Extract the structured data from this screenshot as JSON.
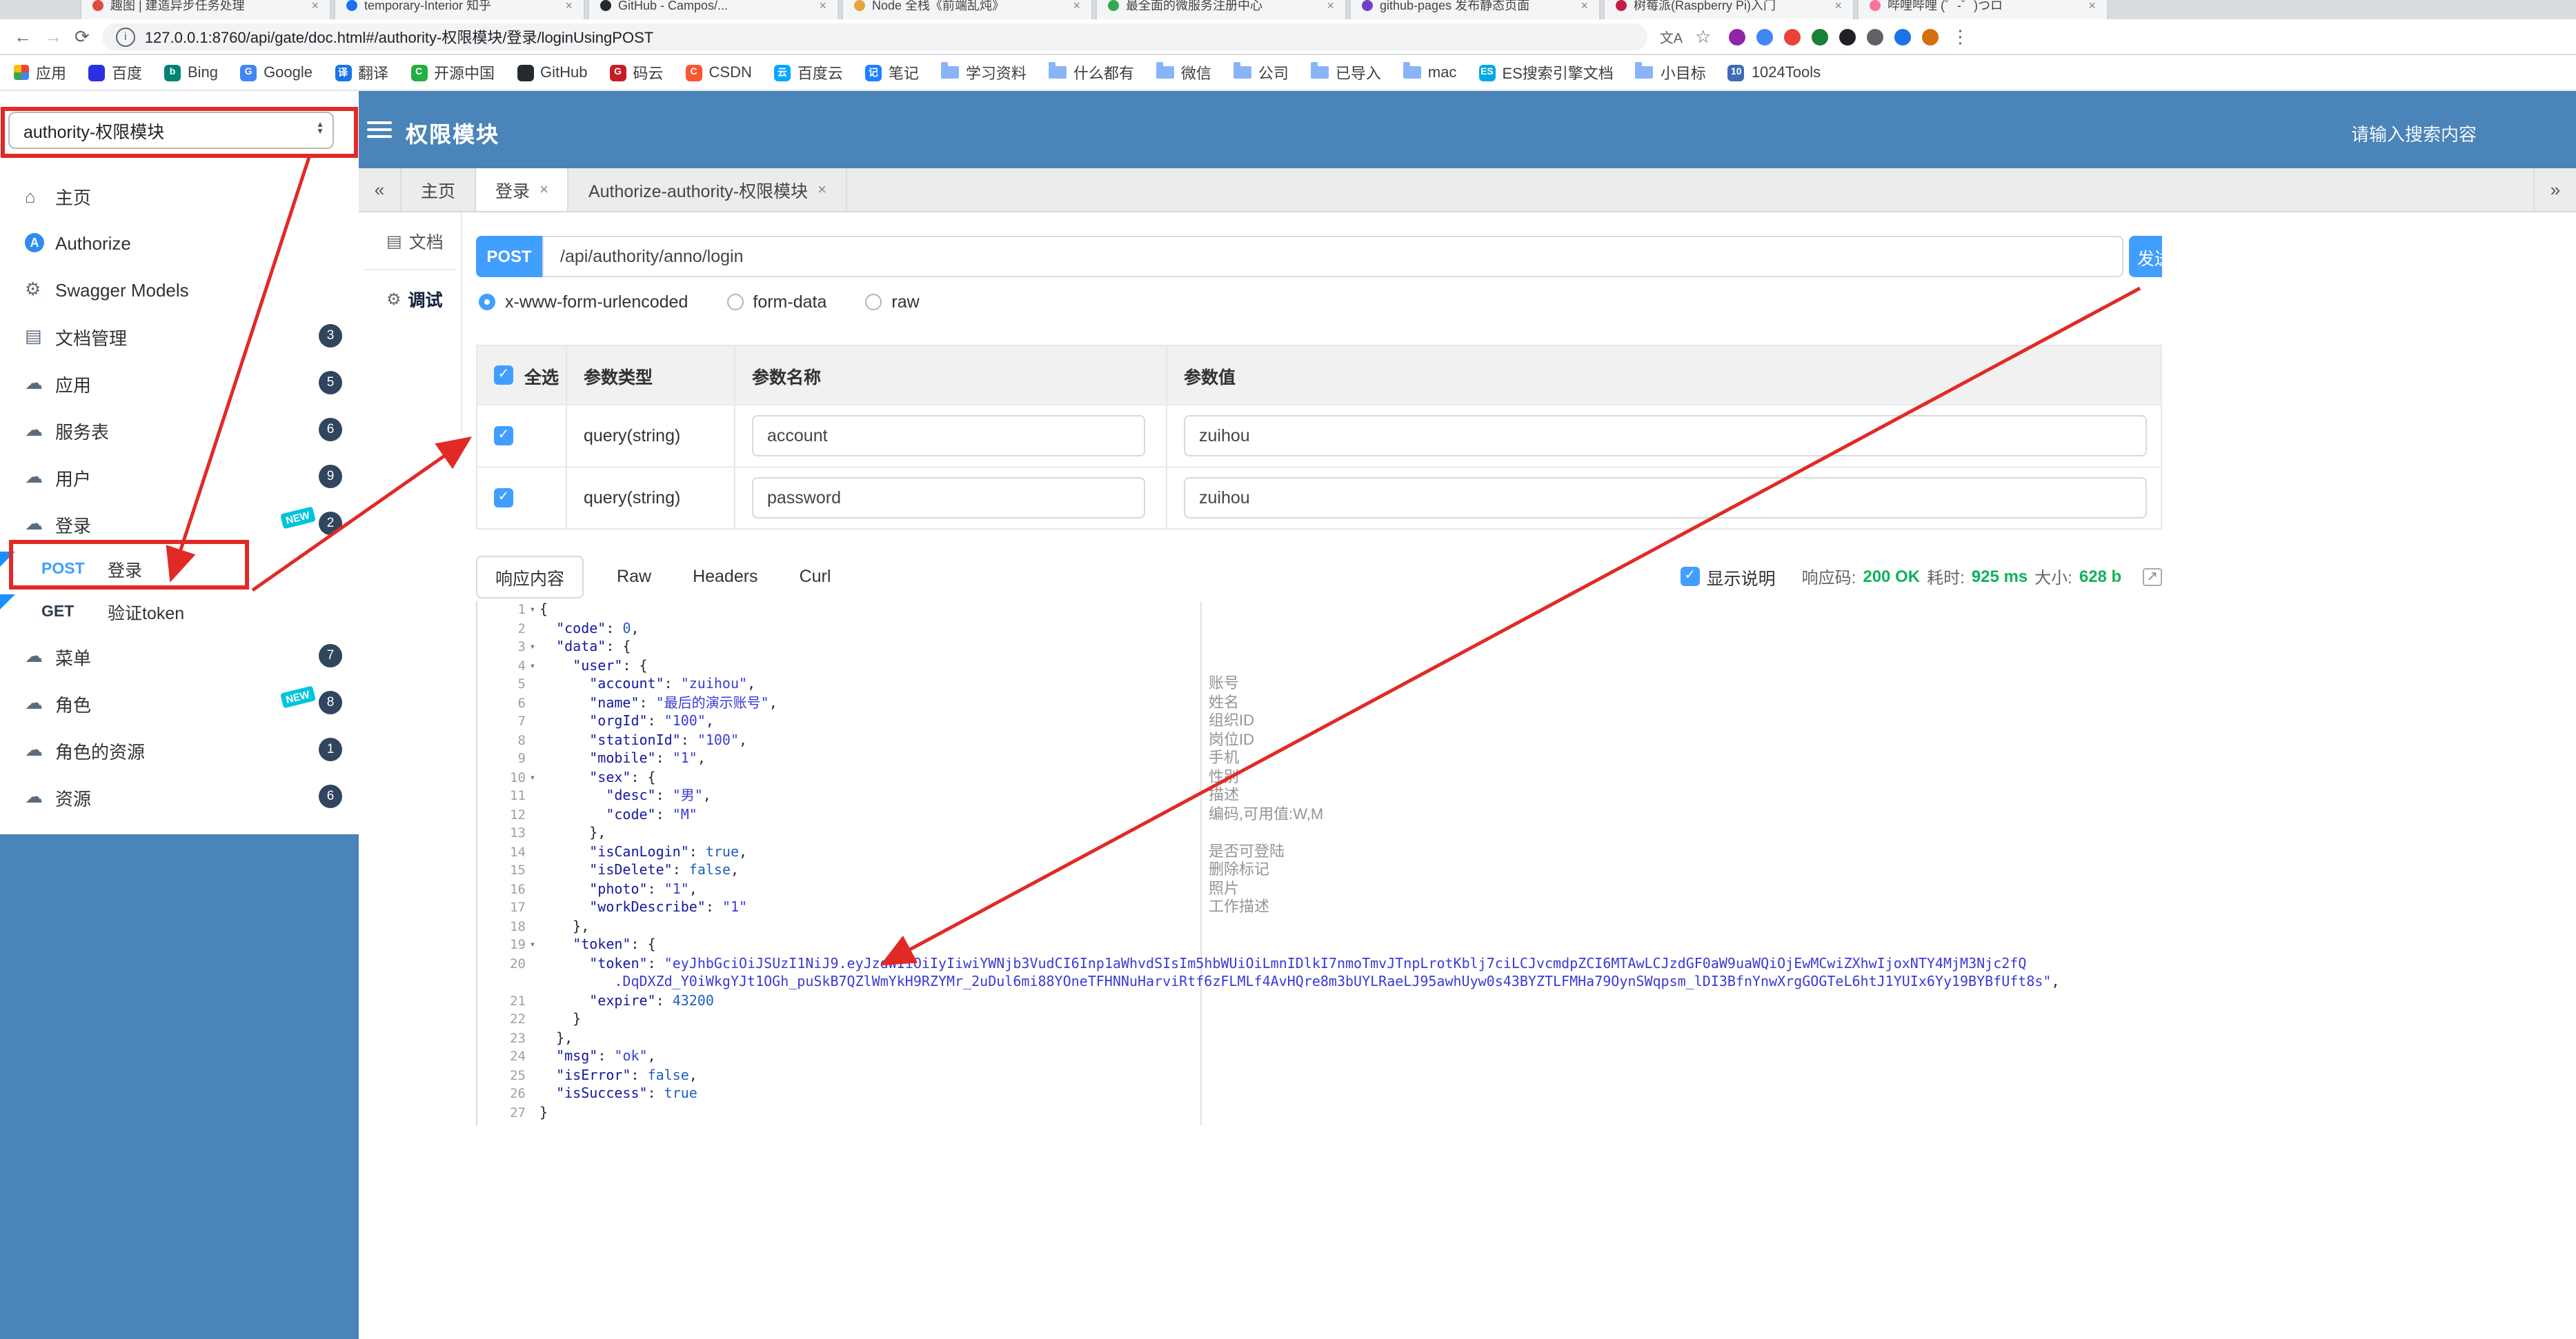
{
  "colors": {
    "header_blue": "#4a84b8",
    "primary_blue": "#409eff",
    "annotation_red": "#e12a26",
    "success_green": "#0db35b",
    "badge_navy": "#30455e",
    "new_tag_teal": "#00c5dc",
    "method_link_blue": "#1890ff"
  },
  "browser": {
    "window_tabs": [
      {
        "title": "趣图 | 建造异步任务处理",
        "color": "#e04a3f"
      },
      {
        "title": "temporary-Interior 知乎",
        "color": "#1772f6"
      },
      {
        "title": "GitHub - Campos/...",
        "color": "#24292e"
      },
      {
        "title": "Node 全栈《前端乱炖》",
        "color": "#e8a33d"
      },
      {
        "title": "最全面的微服务注册中心",
        "color": "#34a853"
      },
      {
        "title": "github-pages 发布静态页面",
        "color": "#6f42c1"
      },
      {
        "title": "树莓派(Raspberry Pi)入门",
        "color": "#c51a4a"
      },
      {
        "title": "哔哩哔哩 (゜-゜)つロ",
        "color": "#fb7299"
      }
    ],
    "nav": {
      "back": "←",
      "forward": "→",
      "reload": "⟳",
      "url": "127.0.0.1:8760/api/gate/doc.html#/authority-权限模块/登录/loginUsingPOST",
      "ext_icon_colors": [
        "#8e24aa",
        "#4285f4",
        "#ea4335",
        "#188038",
        "#202124",
        "#5f6368",
        "#1a73e8",
        "#d56e0c"
      ]
    },
    "bookmarks": [
      {
        "label": "应用",
        "icon": "apps-grid"
      },
      {
        "label": "百度",
        "icon": "dot",
        "color": "#2932e1",
        "glyph": ""
      },
      {
        "label": "Bing",
        "icon": "dot",
        "color": "#008373",
        "glyph": "b"
      },
      {
        "label": "Google",
        "icon": "dot",
        "color": "#4285f4",
        "glyph": "G"
      },
      {
        "label": "翻译",
        "icon": "dot",
        "color": "#1a73e8",
        "glyph": "译"
      },
      {
        "label": "开源中国",
        "icon": "dot",
        "color": "#24af41",
        "glyph": "C"
      },
      {
        "label": "GitHub",
        "icon": "dot",
        "color": "#24292e",
        "glyph": ""
      },
      {
        "label": "码云",
        "icon": "dot",
        "color": "#c71d23",
        "glyph": "G"
      },
      {
        "label": "CSDN",
        "icon": "dot",
        "color": "#fc5531",
        "glyph": "C"
      },
      {
        "label": "百度云",
        "icon": "dot",
        "color": "#06a7ff",
        "glyph": "云"
      },
      {
        "label": "笔记",
        "icon": "dot",
        "color": "#1e80ff",
        "glyph": "记"
      },
      {
        "label": "学习资料",
        "icon": "folder"
      },
      {
        "label": "什么都有",
        "icon": "folder"
      },
      {
        "label": "微信",
        "icon": "folder"
      },
      {
        "label": "公司",
        "icon": "folder"
      },
      {
        "label": "已导入",
        "icon": "folder"
      },
      {
        "label": "mac",
        "icon": "folder"
      },
      {
        "label": "ES搜索引擎文档",
        "icon": "dot",
        "color": "#00a9e5",
        "glyph": "ES"
      },
      {
        "label": "小目标",
        "icon": "folder"
      },
      {
        "label": "1024Tools",
        "icon": "dot",
        "color": "#3e6db5",
        "glyph": "10"
      }
    ]
  },
  "app_header": {
    "module_select": "authority-权限模块",
    "title": "权限模块",
    "search_placeholder": "请输入搜索内容"
  },
  "sidebar": {
    "items": [
      {
        "label": "主页",
        "icon": "home-icon"
      },
      {
        "label": "Authorize",
        "icon": "authorize-icon"
      },
      {
        "label": "Swagger Models",
        "icon": "models-icon"
      },
      {
        "label": "文档管理",
        "icon": "docs-icon",
        "badge": "3"
      },
      {
        "label": "应用",
        "icon": "cloud-icon",
        "badge": "5"
      },
      {
        "label": "服务表",
        "icon": "cloud-icon",
        "badge": "6"
      },
      {
        "label": "用户",
        "icon": "cloud-icon",
        "badge": "9"
      },
      {
        "label": "登录",
        "icon": "cloud-icon",
        "badge": "2",
        "new": true,
        "children": [
          {
            "method": "POST",
            "label": "登录"
          },
          {
            "method": "GET",
            "label": "验证token"
          }
        ]
      },
      {
        "label": "菜单",
        "icon": "cloud-icon",
        "badge": "7"
      },
      {
        "label": "角色",
        "icon": "cloud-icon",
        "badge": "8",
        "new": true
      },
      {
        "label": "角色的资源",
        "icon": "cloud-icon",
        "badge": "1"
      },
      {
        "label": "资源",
        "icon": "cloud-icon",
        "badge": "6"
      }
    ]
  },
  "content_tabs": {
    "left_arrow": "«",
    "right_arrow": "»",
    "tabs": [
      {
        "label": "主页",
        "closable": false,
        "active": false
      },
      {
        "label": "登录",
        "closable": true,
        "active": true
      },
      {
        "label": "Authorize-authority-权限模块",
        "closable": true,
        "active": false
      }
    ]
  },
  "doc_panel": {
    "doc": "文档",
    "debug": "调试"
  },
  "request": {
    "method": "POST",
    "url": "/api/authority/anno/login",
    "send_label": "发送",
    "content_types": [
      {
        "label": "x-www-form-urlencoded",
        "selected": true
      },
      {
        "label": "form-data",
        "selected": false
      },
      {
        "label": "raw",
        "selected": false
      }
    ]
  },
  "params_table": {
    "select_all": "全选",
    "columns": [
      "参数类型",
      "参数名称",
      "参数值"
    ],
    "rows": [
      {
        "checked": true,
        "type": "query(string)",
        "name": "account",
        "value": "zuihou"
      },
      {
        "checked": true,
        "type": "query(string)",
        "name": "password",
        "value": "zuihou"
      }
    ]
  },
  "response": {
    "tabs": [
      "响应内容",
      "Raw",
      "Headers",
      "Curl"
    ],
    "active_tab": "响应内容",
    "show_desc_label": "显示说明",
    "show_desc_checked": true,
    "meta": {
      "code_label": "响应码:",
      "code_value": "200 OK",
      "time_label": "耗时:",
      "time_value": "925 ms",
      "size_label": "大小:",
      "size_value": "628 b"
    }
  },
  "code_view": {
    "lines": [
      {
        "num": "1",
        "fold": true,
        "tokens": [
          [
            "p",
            "{"
          ]
        ]
      },
      {
        "num": "2",
        "tokens": [
          [
            "p",
            "  "
          ],
          [
            "k",
            "\"code\""
          ],
          [
            "p",
            ": "
          ],
          [
            "n",
            "0"
          ],
          [
            "p",
            ","
          ]
        ]
      },
      {
        "num": "3",
        "fold": true,
        "tokens": [
          [
            "p",
            "  "
          ],
          [
            "k",
            "\"data\""
          ],
          [
            "p",
            ": {"
          ]
        ]
      },
      {
        "num": "4",
        "fold": true,
        "tokens": [
          [
            "p",
            "    "
          ],
          [
            "k",
            "\"user\""
          ],
          [
            "p",
            ": {"
          ]
        ]
      },
      {
        "num": "5",
        "tokens": [
          [
            "p",
            "      "
          ],
          [
            "k",
            "\"account\""
          ],
          [
            "p",
            ": "
          ],
          [
            "s",
            "\"zuihou\""
          ],
          [
            "p",
            ","
          ]
        ],
        "comment": "账号"
      },
      {
        "num": "6",
        "tokens": [
          [
            "p",
            "      "
          ],
          [
            "k",
            "\"name\""
          ],
          [
            "p",
            ": "
          ],
          [
            "s",
            "\"最后的演示账号\""
          ],
          [
            "p",
            ","
          ]
        ],
        "comment": "姓名"
      },
      {
        "num": "7",
        "tokens": [
          [
            "p",
            "      "
          ],
          [
            "k",
            "\"orgId\""
          ],
          [
            "p",
            ": "
          ],
          [
            "s",
            "\"100\""
          ],
          [
            "p",
            ","
          ]
        ],
        "comment": "组织ID"
      },
      {
        "num": "8",
        "tokens": [
          [
            "p",
            "      "
          ],
          [
            "k",
            "\"stationId\""
          ],
          [
            "p",
            ": "
          ],
          [
            "s",
            "\"100\""
          ],
          [
            "p",
            ","
          ]
        ],
        "comment": "岗位ID"
      },
      {
        "num": "9",
        "tokens": [
          [
            "p",
            "      "
          ],
          [
            "k",
            "\"mobile\""
          ],
          [
            "p",
            ": "
          ],
          [
            "s",
            "\"1\""
          ],
          [
            "p",
            ","
          ]
        ],
        "comment": "手机"
      },
      {
        "num": "10",
        "fold": true,
        "tokens": [
          [
            "p",
            "      "
          ],
          [
            "k",
            "\"sex\""
          ],
          [
            "p",
            ": {"
          ]
        ],
        "comment": "性别"
      },
      {
        "num": "11",
        "tokens": [
          [
            "p",
            "        "
          ],
          [
            "k",
            "\"desc\""
          ],
          [
            "p",
            ": "
          ],
          [
            "s",
            "\"男\""
          ],
          [
            "p",
            ","
          ]
        ],
        "comment": "描述"
      },
      {
        "num": "12",
        "tokens": [
          [
            "p",
            "        "
          ],
          [
            "k",
            "\"code\""
          ],
          [
            "p",
            ": "
          ],
          [
            "s",
            "\"M\""
          ]
        ],
        "comment": "编码,可用值:W,M"
      },
      {
        "num": "13",
        "tokens": [
          [
            "p",
            "      },"
          ]
        ]
      },
      {
        "num": "14",
        "tokens": [
          [
            "p",
            "      "
          ],
          [
            "k",
            "\"isCanLogin\""
          ],
          [
            "p",
            ": "
          ],
          [
            "n",
            "true"
          ],
          [
            "p",
            ","
          ]
        ],
        "comment": "是否可登陆"
      },
      {
        "num": "15",
        "tokens": [
          [
            "p",
            "      "
          ],
          [
            "k",
            "\"isDelete\""
          ],
          [
            "p",
            ": "
          ],
          [
            "n",
            "false"
          ],
          [
            "p",
            ","
          ]
        ],
        "comment": "删除标记"
      },
      {
        "num": "16",
        "tokens": [
          [
            "p",
            "      "
          ],
          [
            "k",
            "\"photo\""
          ],
          [
            "p",
            ": "
          ],
          [
            "s",
            "\"1\""
          ],
          [
            "p",
            ","
          ]
        ],
        "comment": "照片"
      },
      {
        "num": "17",
        "tokens": [
          [
            "p",
            "      "
          ],
          [
            "k",
            "\"workDescribe\""
          ],
          [
            "p",
            ": "
          ],
          [
            "s",
            "\"1\""
          ]
        ],
        "comment": "工作描述"
      },
      {
        "num": "18",
        "tokens": [
          [
            "p",
            "    },"
          ]
        ]
      },
      {
        "num": "19",
        "fold": true,
        "tokens": [
          [
            "p",
            "    "
          ],
          [
            "k",
            "\"token\""
          ],
          [
            "p",
            ": {"
          ]
        ]
      },
      {
        "num": "20",
        "tokens": [
          [
            "p",
            "      "
          ],
          [
            "k",
            "\"token\""
          ],
          [
            "p",
            ": "
          ],
          [
            "s",
            "\"eyJhbGciOiJSUzI1NiJ9.eyJzdWIiOiIyIiwiYWNjb3VudCI6Inp1aWhvdSIsIm5hbWUiOiLmnIDlkI7nmoTmvJTnpLrotKblj7ciLCJvcmdpZCI6MTAwLCJzdGF0aW9uaWQiOjEwMCwiZXhwIjoxNTY4MjM3Njc2fQ"
          ]
        ]
      },
      {
        "num": "",
        "tokens": [
          [
            "p",
            "         "
          ],
          [
            "s",
            ".DqDXZd_Y0iWkgYJt1OGh_puSkB7QZlWmYkH9RZYMr_2uDul6mi88YOneTFHNNuHarviRtf6zFLMLf4AvHQre8m3bUYLRaeLJ95awhUyw0s43BYZTLFMHa79OynSWqpsm_lDI3BfnYnwXrgGOGTeL6htJ1YUIx6Yy19BYBfUft8s\""
          ],
          [
            "p",
            ","
          ]
        ]
      },
      {
        "num": "21",
        "tokens": [
          [
            "p",
            "      "
          ],
          [
            "k",
            "\"expire\""
          ],
          [
            "p",
            ": "
          ],
          [
            "n",
            "43200"
          ]
        ]
      },
      {
        "num": "22",
        "tokens": [
          [
            "p",
            "    }"
          ]
        ]
      },
      {
        "num": "23",
        "tokens": [
          [
            "p",
            "  },"
          ]
        ]
      },
      {
        "num": "24",
        "tokens": [
          [
            "p",
            "  "
          ],
          [
            "k",
            "\"msg\""
          ],
          [
            "p",
            ": "
          ],
          [
            "s",
            "\"ok\""
          ],
          [
            "p",
            ","
          ]
        ]
      },
      {
        "num": "25",
        "tokens": [
          [
            "p",
            "  "
          ],
          [
            "k",
            "\"isError\""
          ],
          [
            "p",
            ": "
          ],
          [
            "n",
            "false"
          ],
          [
            "p",
            ","
          ]
        ]
      },
      {
        "num": "26",
        "tokens": [
          [
            "p",
            "  "
          ],
          [
            "k",
            "\"isSuccess\""
          ],
          [
            "p",
            ": "
          ],
          [
            "n",
            "true"
          ]
        ]
      },
      {
        "num": "27",
        "tokens": [
          [
            "p",
            "}"
          ]
        ]
      }
    ]
  }
}
